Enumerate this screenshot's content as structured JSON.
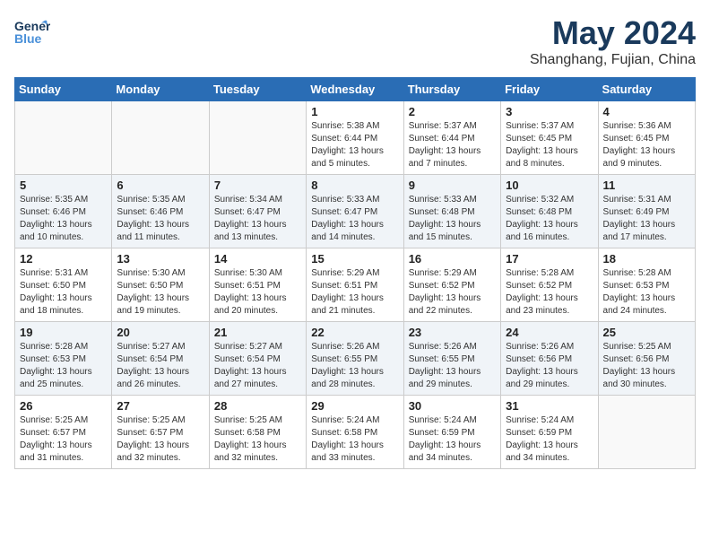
{
  "header": {
    "logo_general": "General",
    "logo_blue": "Blue",
    "title": "May 2024",
    "subtitle": "Shanghang, Fujian, China"
  },
  "columns": [
    "Sunday",
    "Monday",
    "Tuesday",
    "Wednesday",
    "Thursday",
    "Friday",
    "Saturday"
  ],
  "weeks": [
    [
      {
        "day": "",
        "info": ""
      },
      {
        "day": "",
        "info": ""
      },
      {
        "day": "",
        "info": ""
      },
      {
        "day": "1",
        "info": "Sunrise: 5:38 AM\nSunset: 6:44 PM\nDaylight: 13 hours\nand 5 minutes."
      },
      {
        "day": "2",
        "info": "Sunrise: 5:37 AM\nSunset: 6:44 PM\nDaylight: 13 hours\nand 7 minutes."
      },
      {
        "day": "3",
        "info": "Sunrise: 5:37 AM\nSunset: 6:45 PM\nDaylight: 13 hours\nand 8 minutes."
      },
      {
        "day": "4",
        "info": "Sunrise: 5:36 AM\nSunset: 6:45 PM\nDaylight: 13 hours\nand 9 minutes."
      }
    ],
    [
      {
        "day": "5",
        "info": "Sunrise: 5:35 AM\nSunset: 6:46 PM\nDaylight: 13 hours\nand 10 minutes."
      },
      {
        "day": "6",
        "info": "Sunrise: 5:35 AM\nSunset: 6:46 PM\nDaylight: 13 hours\nand 11 minutes."
      },
      {
        "day": "7",
        "info": "Sunrise: 5:34 AM\nSunset: 6:47 PM\nDaylight: 13 hours\nand 13 minutes."
      },
      {
        "day": "8",
        "info": "Sunrise: 5:33 AM\nSunset: 6:47 PM\nDaylight: 13 hours\nand 14 minutes."
      },
      {
        "day": "9",
        "info": "Sunrise: 5:33 AM\nSunset: 6:48 PM\nDaylight: 13 hours\nand 15 minutes."
      },
      {
        "day": "10",
        "info": "Sunrise: 5:32 AM\nSunset: 6:48 PM\nDaylight: 13 hours\nand 16 minutes."
      },
      {
        "day": "11",
        "info": "Sunrise: 5:31 AM\nSunset: 6:49 PM\nDaylight: 13 hours\nand 17 minutes."
      }
    ],
    [
      {
        "day": "12",
        "info": "Sunrise: 5:31 AM\nSunset: 6:50 PM\nDaylight: 13 hours\nand 18 minutes."
      },
      {
        "day": "13",
        "info": "Sunrise: 5:30 AM\nSunset: 6:50 PM\nDaylight: 13 hours\nand 19 minutes."
      },
      {
        "day": "14",
        "info": "Sunrise: 5:30 AM\nSunset: 6:51 PM\nDaylight: 13 hours\nand 20 minutes."
      },
      {
        "day": "15",
        "info": "Sunrise: 5:29 AM\nSunset: 6:51 PM\nDaylight: 13 hours\nand 21 minutes."
      },
      {
        "day": "16",
        "info": "Sunrise: 5:29 AM\nSunset: 6:52 PM\nDaylight: 13 hours\nand 22 minutes."
      },
      {
        "day": "17",
        "info": "Sunrise: 5:28 AM\nSunset: 6:52 PM\nDaylight: 13 hours\nand 23 minutes."
      },
      {
        "day": "18",
        "info": "Sunrise: 5:28 AM\nSunset: 6:53 PM\nDaylight: 13 hours\nand 24 minutes."
      }
    ],
    [
      {
        "day": "19",
        "info": "Sunrise: 5:28 AM\nSunset: 6:53 PM\nDaylight: 13 hours\nand 25 minutes."
      },
      {
        "day": "20",
        "info": "Sunrise: 5:27 AM\nSunset: 6:54 PM\nDaylight: 13 hours\nand 26 minutes."
      },
      {
        "day": "21",
        "info": "Sunrise: 5:27 AM\nSunset: 6:54 PM\nDaylight: 13 hours\nand 27 minutes."
      },
      {
        "day": "22",
        "info": "Sunrise: 5:26 AM\nSunset: 6:55 PM\nDaylight: 13 hours\nand 28 minutes."
      },
      {
        "day": "23",
        "info": "Sunrise: 5:26 AM\nSunset: 6:55 PM\nDaylight: 13 hours\nand 29 minutes."
      },
      {
        "day": "24",
        "info": "Sunrise: 5:26 AM\nSunset: 6:56 PM\nDaylight: 13 hours\nand 29 minutes."
      },
      {
        "day": "25",
        "info": "Sunrise: 5:25 AM\nSunset: 6:56 PM\nDaylight: 13 hours\nand 30 minutes."
      }
    ],
    [
      {
        "day": "26",
        "info": "Sunrise: 5:25 AM\nSunset: 6:57 PM\nDaylight: 13 hours\nand 31 minutes."
      },
      {
        "day": "27",
        "info": "Sunrise: 5:25 AM\nSunset: 6:57 PM\nDaylight: 13 hours\nand 32 minutes."
      },
      {
        "day": "28",
        "info": "Sunrise: 5:25 AM\nSunset: 6:58 PM\nDaylight: 13 hours\nand 32 minutes."
      },
      {
        "day": "29",
        "info": "Sunrise: 5:24 AM\nSunset: 6:58 PM\nDaylight: 13 hours\nand 33 minutes."
      },
      {
        "day": "30",
        "info": "Sunrise: 5:24 AM\nSunset: 6:59 PM\nDaylight: 13 hours\nand 34 minutes."
      },
      {
        "day": "31",
        "info": "Sunrise: 5:24 AM\nSunset: 6:59 PM\nDaylight: 13 hours\nand 34 minutes."
      },
      {
        "day": "",
        "info": ""
      }
    ]
  ]
}
